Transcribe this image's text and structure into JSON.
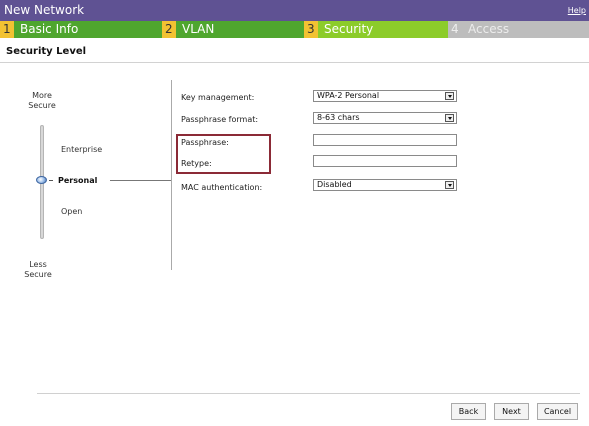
{
  "window": {
    "title": "New Network",
    "help_link": "Help"
  },
  "wizard_steps": [
    {
      "number": "1",
      "label": "Basic Info"
    },
    {
      "number": "2",
      "label": "VLAN"
    },
    {
      "number": "3",
      "label": "Security"
    },
    {
      "number": "4",
      "label": "Access"
    }
  ],
  "current_step": "3",
  "section_title": "Security Level",
  "security_scale": {
    "top_label_line1": "More",
    "top_label_line2": "Secure",
    "bottom_label_line1": "Less",
    "bottom_label_line2": "Secure",
    "levels": [
      "Enterprise",
      "Personal",
      "Open"
    ],
    "selected_level": "Personal"
  },
  "form": {
    "key_management": {
      "label": "Key management:",
      "value": "WPA-2 Personal"
    },
    "passphrase_format": {
      "label": "Passphrase format:",
      "value": "8-63 chars"
    },
    "passphrase": {
      "label": "Passphrase:",
      "value": ""
    },
    "retype": {
      "label": "Retype:",
      "value": ""
    },
    "mac_authentication": {
      "label": "MAC authentication:",
      "value": "Disabled"
    }
  },
  "buttons": {
    "back": "Back",
    "next": "Next",
    "cancel": "Cancel"
  },
  "colors": {
    "titlebar": "#5f5293",
    "step_number": "#f2c232",
    "step_done": "#4fa62e",
    "step_active": "#8ccc2a",
    "step_inactive": "#bdbdbd",
    "highlight_border": "#8b2a36"
  }
}
